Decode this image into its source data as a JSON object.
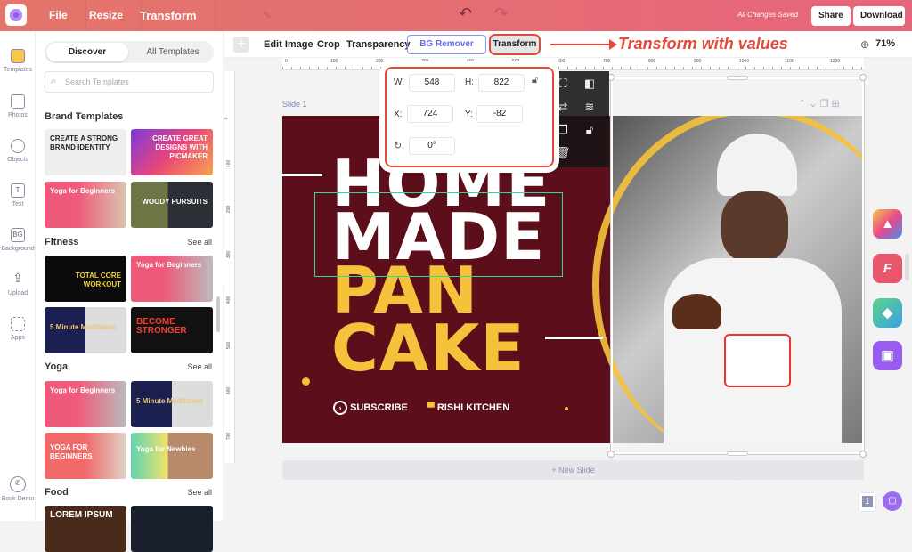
{
  "header": {
    "menu": [
      "File",
      "Resize",
      "Transform"
    ],
    "status": "All Changes Saved",
    "share": "Share",
    "download": "Download"
  },
  "rail": [
    {
      "label": "Templates",
      "icon": "templates-icon"
    },
    {
      "label": "Photos",
      "icon": "photos-icon"
    },
    {
      "label": "Objects",
      "icon": "objects-icon"
    },
    {
      "label": "Text",
      "icon": "text-icon"
    },
    {
      "label": "Background",
      "icon": "bg-icon",
      "glyph": "BG"
    },
    {
      "label": "Upload",
      "icon": "upload-icon"
    },
    {
      "label": "Apps",
      "icon": "apps-icon"
    },
    {
      "label": "Book Demo",
      "icon": "phone-icon"
    }
  ],
  "panel": {
    "tab_discover": "Discover",
    "tab_all": "All Templates",
    "search_placeholder": "Search Templates",
    "sections": [
      {
        "title": "Brand Templates",
        "see_all": "",
        "items": [
          "CREATE A STRONG BRAND IDENTITY",
          "CREATE GREAT DESIGNS WITH PICMAKER",
          "Yoga for Beginners",
          "WOODY PURSUITS"
        ]
      },
      {
        "title": "Fitness",
        "see_all": "See all",
        "items": [
          "TOTAL CORE WORKOUT",
          "Yoga for Beginners",
          "5 Minute Meditation",
          "BECOME STRONGER"
        ]
      },
      {
        "title": "Yoga",
        "see_all": "See all",
        "items": [
          "Yoga for Beginners",
          "5 Minute Meditation",
          "YOGA FOR BEGINNERS",
          "Yoga for Newbies"
        ]
      },
      {
        "title": "Food",
        "see_all": "See all",
        "items": [
          "LOREM IPSUM",
          ""
        ]
      }
    ]
  },
  "toolbar": {
    "edit_image": "Edit Image",
    "crop": "Crop",
    "transparency": "Transparency",
    "bg_remover": "BG Remover",
    "transform": "Transform",
    "annotation": "Transform with values",
    "zoom": "71%"
  },
  "ruler": [
    "0",
    "100",
    "200",
    "300",
    "400",
    "500",
    "600",
    "700",
    "800",
    "900",
    "1000",
    "1100",
    "1200"
  ],
  "vruler": [
    "0",
    "100",
    "200",
    "300",
    "400",
    "500",
    "600",
    "700"
  ],
  "canvas": {
    "slide_label": "Slide 1",
    "new_slide": "+ New Slide",
    "page_count": "1"
  },
  "design": {
    "line1": "HOME",
    "line2": "MADE",
    "line3": "PAN",
    "line4": "CAKE",
    "subscribe": "SUBSCRIBE",
    "brand": "RISHI KITCHEN",
    "colors": {
      "bg": "#5c0f1a",
      "accent": "#f5c33b"
    }
  },
  "transform": {
    "w_label": "W:",
    "w": "548",
    "h_label": "H:",
    "h": "822",
    "x_label": "X:",
    "x": "724",
    "y_label": "Y:",
    "y": "-82",
    "rotation": "0°",
    "locked": false
  },
  "colors": {
    "header_start": "#e3756a",
    "header_end": "#e7657c",
    "highlight": "#e34a3a",
    "bg_remover": "#6b6ff0"
  }
}
